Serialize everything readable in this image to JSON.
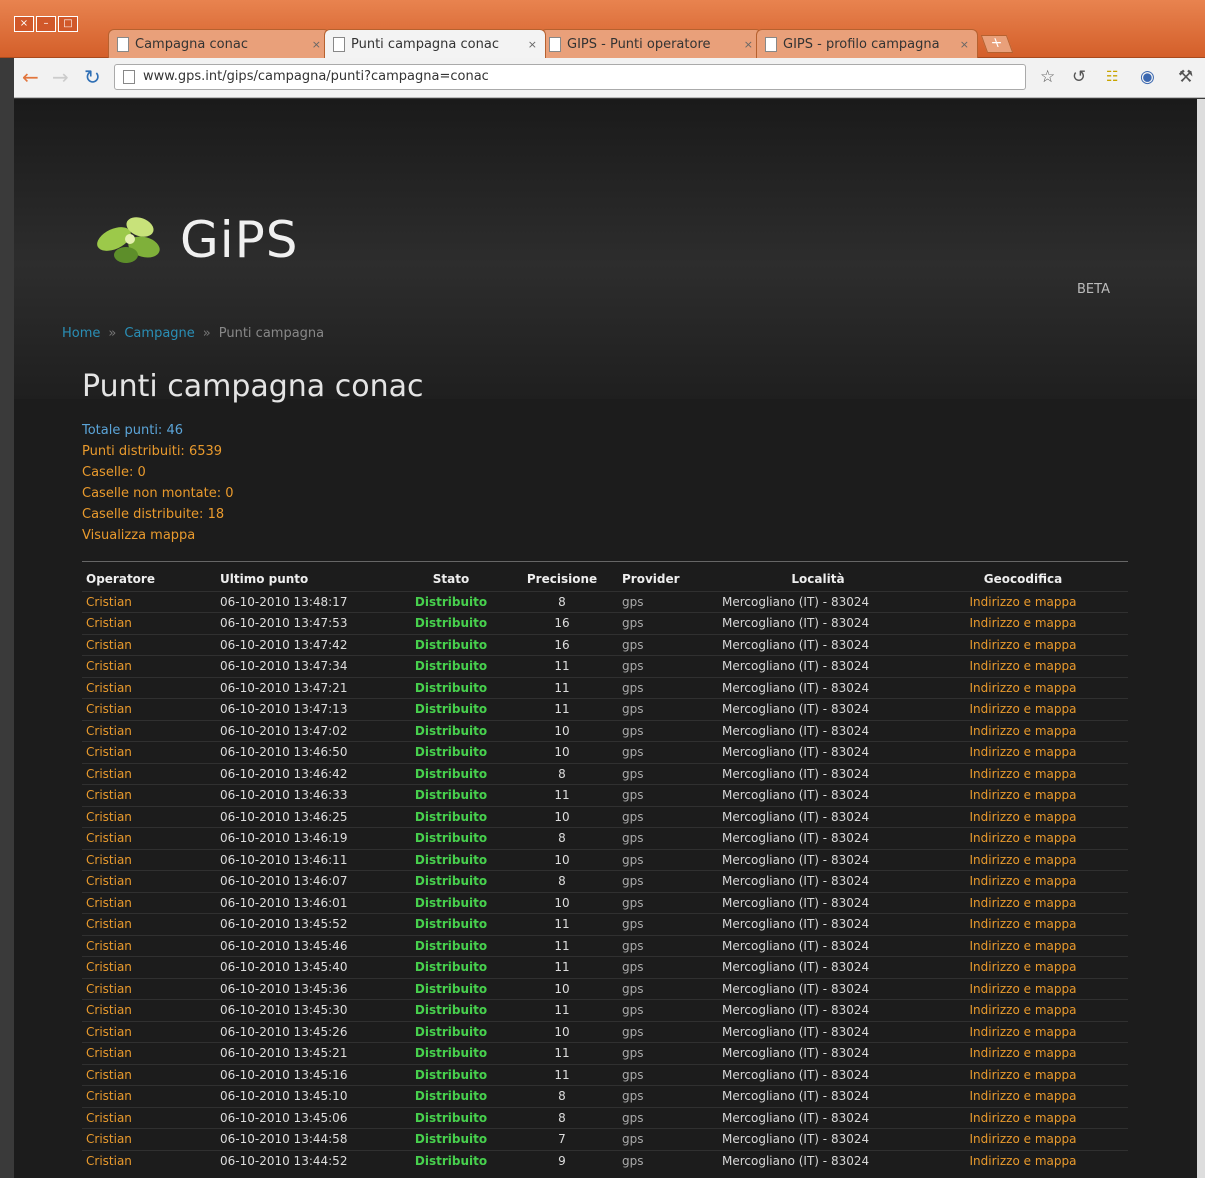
{
  "browser": {
    "window_controls": [
      "×",
      "–",
      "□"
    ],
    "tabs": [
      {
        "label": "Campagna conac",
        "close": "×",
        "active": false
      },
      {
        "label": "Punti campagna conac",
        "close": "×",
        "active": true
      },
      {
        "label": "GIPS - Punti operatore",
        "close": "×",
        "active": false
      },
      {
        "label": "GIPS - profilo campagna",
        "close": "×",
        "active": false
      }
    ],
    "new_tab": "+",
    "url": "www.gps.int/gips/campagna/punti?campagna=conac"
  },
  "site": {
    "logo_text": "GiPS",
    "beta": "BETA"
  },
  "breadcrumb": {
    "home": "Home",
    "campaigns": "Campagne",
    "current": "Punti campagna"
  },
  "page": {
    "title": "Punti campagna conac"
  },
  "stats": {
    "total": "Totale punti: 46",
    "distributed": "Punti distribuiti: 6539",
    "boxes": "Caselle: 0",
    "unmounted": "Caselle non montate: 0",
    "boxes_distributed": "Caselle distribuite: 18",
    "map": "Visualizza mappa"
  },
  "table": {
    "headers": [
      "Operatore",
      "Ultimo punto",
      "Stato",
      "Precisione",
      "Provider",
      "Località",
      "Geocodifica"
    ],
    "rows": [
      [
        "Cristian",
        "06-10-2010 13:48:17",
        "Distribuito",
        "8",
        "gps",
        "Mercogliano (IT) - 83024",
        "Indirizzo e mappa"
      ],
      [
        "Cristian",
        "06-10-2010 13:47:53",
        "Distribuito",
        "16",
        "gps",
        "Mercogliano (IT) - 83024",
        "Indirizzo e mappa"
      ],
      [
        "Cristian",
        "06-10-2010 13:47:42",
        "Distribuito",
        "16",
        "gps",
        "Mercogliano (IT) - 83024",
        "Indirizzo e mappa"
      ],
      [
        "Cristian",
        "06-10-2010 13:47:34",
        "Distribuito",
        "11",
        "gps",
        "Mercogliano (IT) - 83024",
        "Indirizzo e mappa"
      ],
      [
        "Cristian",
        "06-10-2010 13:47:21",
        "Distribuito",
        "11",
        "gps",
        "Mercogliano (IT) - 83024",
        "Indirizzo e mappa"
      ],
      [
        "Cristian",
        "06-10-2010 13:47:13",
        "Distribuito",
        "11",
        "gps",
        "Mercogliano (IT) - 83024",
        "Indirizzo e mappa"
      ],
      [
        "Cristian",
        "06-10-2010 13:47:02",
        "Distribuito",
        "10",
        "gps",
        "Mercogliano (IT) - 83024",
        "Indirizzo e mappa"
      ],
      [
        "Cristian",
        "06-10-2010 13:46:50",
        "Distribuito",
        "10",
        "gps",
        "Mercogliano (IT) - 83024",
        "Indirizzo e mappa"
      ],
      [
        "Cristian",
        "06-10-2010 13:46:42",
        "Distribuito",
        "8",
        "gps",
        "Mercogliano (IT) - 83024",
        "Indirizzo e mappa"
      ],
      [
        "Cristian",
        "06-10-2010 13:46:33",
        "Distribuito",
        "11",
        "gps",
        "Mercogliano (IT) - 83024",
        "Indirizzo e mappa"
      ],
      [
        "Cristian",
        "06-10-2010 13:46:25",
        "Distribuito",
        "10",
        "gps",
        "Mercogliano (IT) - 83024",
        "Indirizzo e mappa"
      ],
      [
        "Cristian",
        "06-10-2010 13:46:19",
        "Distribuito",
        "8",
        "gps",
        "Mercogliano (IT) - 83024",
        "Indirizzo e mappa"
      ],
      [
        "Cristian",
        "06-10-2010 13:46:11",
        "Distribuito",
        "10",
        "gps",
        "Mercogliano (IT) - 83024",
        "Indirizzo e mappa"
      ],
      [
        "Cristian",
        "06-10-2010 13:46:07",
        "Distribuito",
        "8",
        "gps",
        "Mercogliano (IT) - 83024",
        "Indirizzo e mappa"
      ],
      [
        "Cristian",
        "06-10-2010 13:46:01",
        "Distribuito",
        "10",
        "gps",
        "Mercogliano (IT) - 83024",
        "Indirizzo e mappa"
      ],
      [
        "Cristian",
        "06-10-2010 13:45:52",
        "Distribuito",
        "11",
        "gps",
        "Mercogliano (IT) - 83024",
        "Indirizzo e mappa"
      ],
      [
        "Cristian",
        "06-10-2010 13:45:46",
        "Distribuito",
        "11",
        "gps",
        "Mercogliano (IT) - 83024",
        "Indirizzo e mappa"
      ],
      [
        "Cristian",
        "06-10-2010 13:45:40",
        "Distribuito",
        "11",
        "gps",
        "Mercogliano (IT) - 83024",
        "Indirizzo e mappa"
      ],
      [
        "Cristian",
        "06-10-2010 13:45:36",
        "Distribuito",
        "10",
        "gps",
        "Mercogliano (IT) - 83024",
        "Indirizzo e mappa"
      ],
      [
        "Cristian",
        "06-10-2010 13:45:30",
        "Distribuito",
        "11",
        "gps",
        "Mercogliano (IT) - 83024",
        "Indirizzo e mappa"
      ],
      [
        "Cristian",
        "06-10-2010 13:45:26",
        "Distribuito",
        "10",
        "gps",
        "Mercogliano (IT) - 83024",
        "Indirizzo e mappa"
      ],
      [
        "Cristian",
        "06-10-2010 13:45:21",
        "Distribuito",
        "11",
        "gps",
        "Mercogliano (IT) - 83024",
        "Indirizzo e mappa"
      ],
      [
        "Cristian",
        "06-10-2010 13:45:16",
        "Distribuito",
        "11",
        "gps",
        "Mercogliano (IT) - 83024",
        "Indirizzo e mappa"
      ],
      [
        "Cristian",
        "06-10-2010 13:45:10",
        "Distribuito",
        "8",
        "gps",
        "Mercogliano (IT) - 83024",
        "Indirizzo e mappa"
      ],
      [
        "Cristian",
        "06-10-2010 13:45:06",
        "Distribuito",
        "8",
        "gps",
        "Mercogliano (IT) - 83024",
        "Indirizzo e mappa"
      ],
      [
        "Cristian",
        "06-10-2010 13:44:58",
        "Distribuito",
        "7",
        "gps",
        "Mercogliano (IT) - 83024",
        "Indirizzo e mappa"
      ],
      [
        "Cristian",
        "06-10-2010 13:44:52",
        "Distribuito",
        "9",
        "gps",
        "Mercogliano (IT) - 83024",
        "Indirizzo e mappa"
      ]
    ]
  },
  "icons": {
    "back": "arrow-left-icon",
    "forward": "arrow-right-icon",
    "reload": "reload-icon",
    "star": "star-icon",
    "page": "page-icon",
    "wrench": "wrench-icon"
  },
  "colors": {
    "accent_orange": "#e99a2d",
    "status_green": "#47d04d",
    "link_blue": "#5ba4d8",
    "background": "#1c1c1c"
  }
}
